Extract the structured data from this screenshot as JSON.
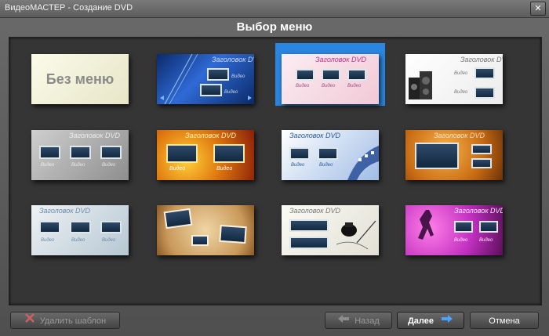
{
  "window": {
    "title": "ВидеоМАСТЕР - Создание DVD",
    "close_glyph": "✕"
  },
  "heading": "Выбор меню",
  "templates": {
    "no_menu": "Без меню",
    "title_text": "Заголовок DVD",
    "video_label": "Видео"
  },
  "buttons": {
    "delete_template": "Удалить шаблон",
    "back": "Назад",
    "next": "Далее",
    "cancel": "Отмена"
  },
  "selected_template": "template-3",
  "colors": {
    "selection": "#2a86e0",
    "panel": "#353535"
  }
}
